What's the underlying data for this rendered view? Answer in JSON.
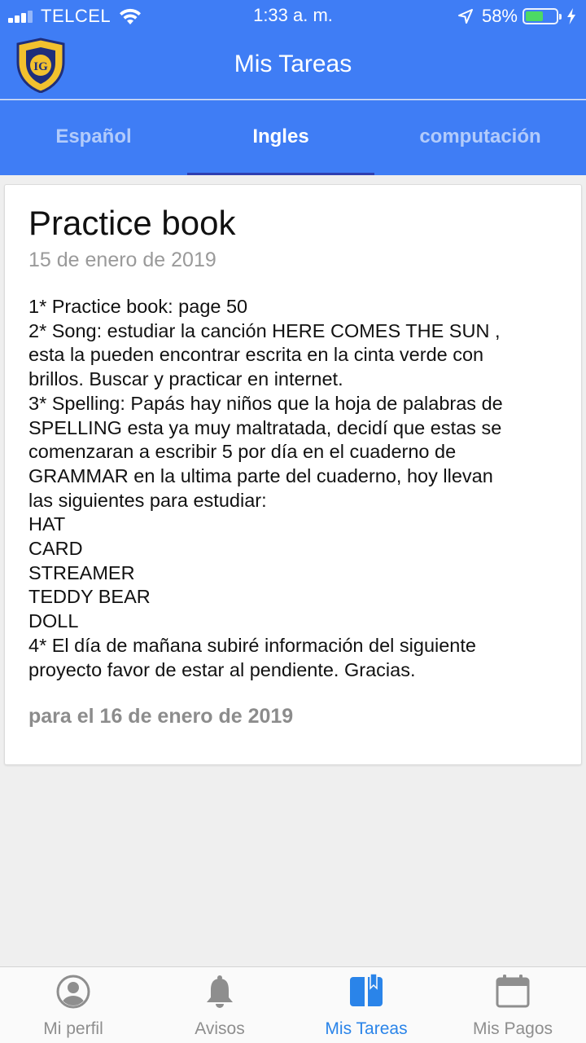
{
  "status_bar": {
    "carrier": "TELCEL",
    "time": "1:33 a. m.",
    "battery_percent": "58%",
    "battery_level": 0.58,
    "icons": [
      "signal-icon",
      "wifi-icon",
      "location-arrow-icon",
      "battery-icon",
      "charging-bolt-icon"
    ]
  },
  "header": {
    "title": "Mis Tareas",
    "logo_text": "IG"
  },
  "tabs": [
    {
      "label": "Español",
      "active": false
    },
    {
      "label": "Ingles",
      "active": true
    },
    {
      "label": "computación",
      "active": false
    }
  ],
  "task": {
    "title": "Practice book",
    "date": "15 de enero de 2019",
    "lines": [
      "1* Practice book: page 50",
      "2* Song: estudiar la canción HERE COMES THE SUN ,",
      "esta la pueden encontrar escrita en la cinta verde con",
      "brillos. Buscar y practicar en  internet.",
      "3* Spelling: Papás hay niños que la hoja de palabras de",
      "SPELLING esta ya muy maltratada, decidí que estas se",
      "comenzaran a escribir 5 por día en el cuaderno de",
      "GRAMMAR en la ultima parte del cuaderno, hoy llevan",
      "las siguientes para estudiar:",
      "HAT",
      "CARD",
      "STREAMER",
      "TEDDY BEAR",
      "DOLL",
      "4* El día de mañana subiré información del siguiente",
      "proyecto favor de estar al pendiente. Gracias."
    ],
    "due": "para el 16 de enero de 2019"
  },
  "tabbar": [
    {
      "label": "Mi perfil",
      "icon": "profile-icon",
      "active": false
    },
    {
      "label": "Avisos",
      "icon": "bell-icon",
      "active": false
    },
    {
      "label": "Mis Tareas",
      "icon": "book-icon",
      "active": true
    },
    {
      "label": "Mis Pagos",
      "icon": "calendar-icon",
      "active": false
    }
  ],
  "colors": {
    "primary": "#3f7df5",
    "tab_indicator": "#2f3fb0",
    "active_tabbar": "#2a84e9",
    "inactive_tabbar": "#8e8e8e",
    "battery_green": "#4cd964",
    "logo_gold": "#f2c12e",
    "logo_navy": "#1f2e7a"
  }
}
